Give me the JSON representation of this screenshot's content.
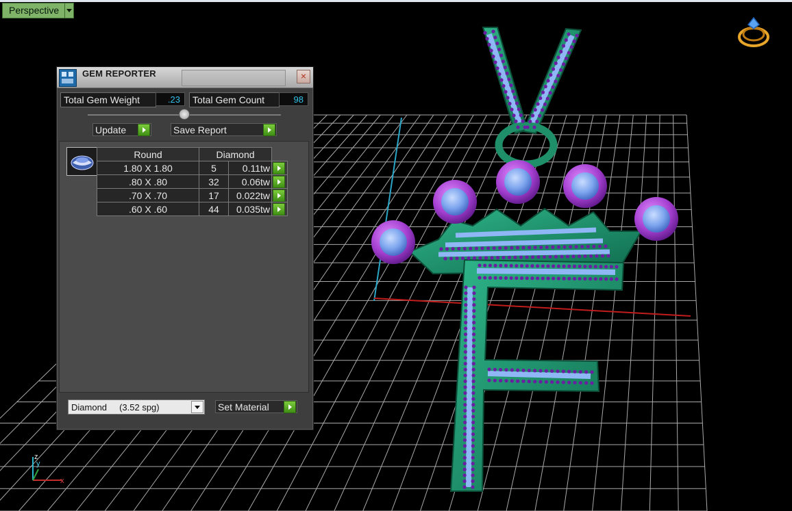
{
  "viewport": {
    "view_label": "Perspective"
  },
  "gem_reporter": {
    "title": "GEM REPORTER",
    "total_weight_label": "Total Gem Weight",
    "total_weight_value": ".23",
    "total_count_label": "Total Gem Count",
    "total_count_value": "98",
    "update_label": "Update",
    "save_report_label": "Save Report",
    "table": {
      "shape_header": "Round",
      "material_header": "Diamond",
      "rows": [
        {
          "size": "1.80 X 1.80",
          "count": "5",
          "weight": "0.11tw"
        },
        {
          "size": ".80 X .80",
          "count": "32",
          "weight": "0.06tw"
        },
        {
          "size": ".70 X .70",
          "count": "17",
          "weight": "0.022tw"
        },
        {
          "size": ".60 X .60",
          "count": "44",
          "weight": "0.035tw"
        }
      ]
    },
    "material_value": "Diamond     (3.52 spg)",
    "set_material_label": "Set Material"
  },
  "axes": {
    "z": "z",
    "y": "y",
    "x": "x"
  },
  "colors": {
    "accent_green": "#7fb468",
    "metal": "#1f8f6a",
    "stone": "#8fb6f5",
    "bezel": "#a43fd0",
    "grid": "#c8c8c8"
  }
}
